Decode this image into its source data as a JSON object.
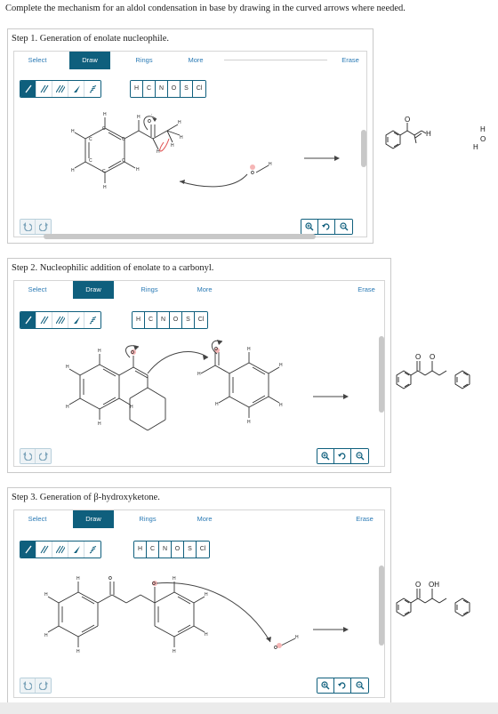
{
  "instructions": "Complete the mechanism for an aldol condensation in base by drawing in the curved arrows where needed.",
  "toolbar": {
    "select": "Select",
    "draw": "Draw",
    "rings": "Rings",
    "more": "More",
    "erase": "Erase",
    "atoms": [
      "H",
      "C",
      "N",
      "O",
      "S",
      "Cl"
    ],
    "bond_tools": [
      "single-bond-icon",
      "double-bond-icon",
      "triple-bond-icon",
      "wedge-bond-icon",
      "hash-bond-icon"
    ]
  },
  "steps": [
    {
      "title": "Step 1. Generation of enolate nucleophile."
    },
    {
      "title": "Step 2. Nucleophilic addition of enolate to a carbonyl."
    },
    {
      "title": "Step 3. Generation of β-hydroxyketone."
    }
  ],
  "products": {
    "step1": {
      "o_label": "O",
      "h_label": "H",
      "water_h1": "H",
      "water_o": "O",
      "water_h2": "H"
    },
    "step2": {
      "o1_label": "O",
      "o2_label": "O"
    },
    "step3": {
      "o_label": "O",
      "oh_label": "OH"
    }
  },
  "colors": {
    "accent": "#0f5f7d",
    "link": "#2a7ab5",
    "arrow": "#444444",
    "charge": "#e05050"
  }
}
